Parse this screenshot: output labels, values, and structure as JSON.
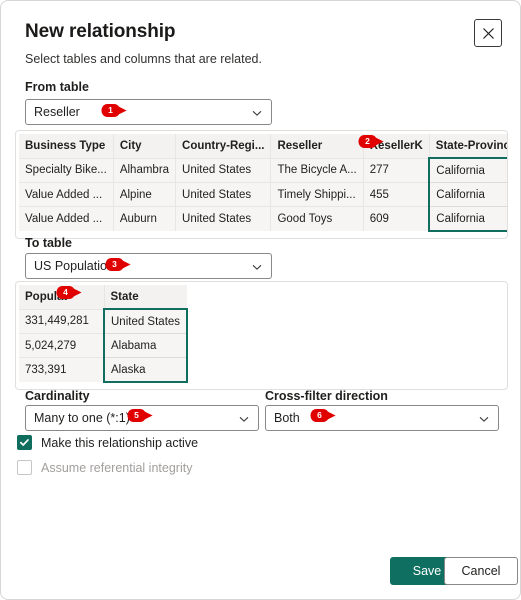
{
  "dialog": {
    "title": "New relationship",
    "subtitle": "Select tables and columns that are related.",
    "close_icon": "close-icon"
  },
  "from_table": {
    "label": "From table",
    "selected": "Reseller",
    "chevron_icon": "chevron-down-icon",
    "columns": [
      "Business Type",
      "City",
      "Country-Regi...",
      "Reseller",
      "ResellerK",
      "State-Province"
    ],
    "selected_column": "State-Province",
    "rows": [
      [
        "Specialty Bike...",
        "Alhambra",
        "United States",
        "The Bicycle A...",
        "277",
        "California"
      ],
      [
        "Value Added ...",
        "Alpine",
        "United States",
        "Timely Shippi...",
        "455",
        "California"
      ],
      [
        "Value Added ...",
        "Auburn",
        "United States",
        "Good Toys",
        "609",
        "California"
      ]
    ]
  },
  "to_table": {
    "label": "To table",
    "selected": "US Population",
    "chevron_icon": "chevron-down-icon",
    "columns": [
      "Populat",
      "State"
    ],
    "selected_column": "State",
    "rows": [
      [
        "331,449,281",
        "United States"
      ],
      [
        "5,024,279",
        "Alabama"
      ],
      [
        "733,391",
        "Alaska"
      ]
    ]
  },
  "cardinality": {
    "label": "Cardinality",
    "selected": "Many to one (*:1)",
    "chevron_icon": "chevron-down-icon"
  },
  "cross_filter": {
    "label": "Cross-filter direction",
    "selected": "Both",
    "chevron_icon": "chevron-down-icon"
  },
  "options": {
    "active": {
      "label": "Make this relationship active",
      "checked": true,
      "enabled": true
    },
    "referential_integrity": {
      "label": "Assume referential integrity",
      "checked": false,
      "enabled": false
    }
  },
  "footer": {
    "save_label": "Save",
    "cancel_label": "Cancel"
  },
  "callouts": [
    {
      "number": "1",
      "target": "from-table-dropdown"
    },
    {
      "number": "2",
      "target": "from-table-selected-column-header"
    },
    {
      "number": "3",
      "target": "to-table-dropdown"
    },
    {
      "number": "4",
      "target": "to-table-population-column-header"
    },
    {
      "number": "5",
      "target": "cardinality-dropdown"
    },
    {
      "number": "6",
      "target": "cross-filter-direction-dropdown"
    }
  ],
  "colors": {
    "accent_green": "#0f7061",
    "selection_border": "#0f6e5e",
    "callout_red": "#e00000",
    "header_gray": "#f3f2f1"
  }
}
